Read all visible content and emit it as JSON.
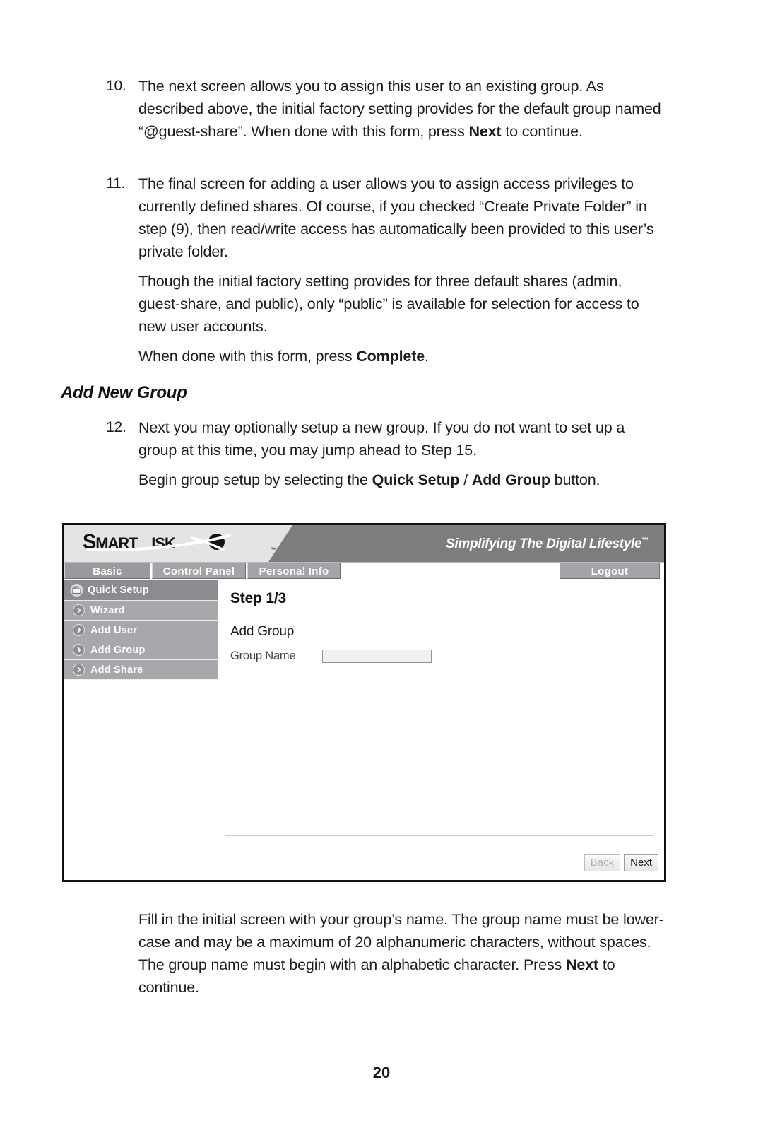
{
  "document": {
    "page_number": "20",
    "section_heading": "Add New Group",
    "items": [
      {
        "number": "10.",
        "parts": [
          {
            "t": "The next screen allows you to assign this user to an existing group. As described above, the initial factory setting provides for the default group named “@guest-share”. When done with this form, press ",
            "b": false
          },
          {
            "t": "Next",
            "b": true
          },
          {
            "t": " to continue.",
            "b": false
          }
        ]
      },
      {
        "number": "11.",
        "parts": [
          {
            "t": "The final screen for adding a user allows you to assign access privileges to currently defined shares. Of course, if you checked “Create Private Folder” in step (9), then read/write access has automatically been provided to this user’s private folder.",
            "b": false
          }
        ]
      }
    ],
    "para_11b": "Though the initial factory setting provides for three default shares (admin, guest-share, and public), only “public” is available for selection for access to new user accounts.",
    "para_11c_pre": "When done with this form, press ",
    "para_11c_bold": "Complete",
    "para_11c_post": ".",
    "item_12_number": "12.",
    "item_12_text": "Next you may optionally setup a new group. If you do not want to set up a group at this time, you may jump ahead to Step 15.",
    "item_12b_pre": "Begin group setup by selecting the ",
    "item_12b_bold1": "Quick Setup",
    "item_12b_mid": " / ",
    "item_12b_bold2": "Add Group",
    "item_12b_post": " button.",
    "closing_paragraph_pre": "Fill in the initial screen with your group’s name. The group name must be lower-case and may be a maximum of 20 alphanumeric characters, without spaces. The group name must begin with an alphabetic character. Press ",
    "closing_paragraph_bold": "Next",
    "closing_paragraph_post": " to continue."
  },
  "screenshot": {
    "brand": {
      "logo_part1": "S",
      "logo_part2": "MART",
      "logo_part3": "ISK",
      "logo_trademark": "™",
      "tagline": "Simplifying The Digital Lifestyle",
      "tagline_tm": "™"
    },
    "tabs": [
      {
        "label": "Basic",
        "active": true
      },
      {
        "label": "Control Panel",
        "active": false
      },
      {
        "label": "Personal Info",
        "active": false
      }
    ],
    "logout_label": "Logout",
    "sidebar": {
      "header": {
        "label": "Quick Setup",
        "icon": "folder-icon"
      },
      "items": [
        {
          "label": "Wizard",
          "icon": "chevron-right-circle-icon"
        },
        {
          "label": "Add User",
          "icon": "chevron-right-circle-icon"
        },
        {
          "label": "Add Group",
          "icon": "chevron-right-circle-icon"
        },
        {
          "label": "Add Share",
          "icon": "chevron-right-circle-icon"
        }
      ]
    },
    "main": {
      "step_title": "Step 1/3",
      "form_title": "Add Group",
      "field_label": "Group Name",
      "field_value": "",
      "field_placeholder": ""
    },
    "buttons": {
      "back": "Back",
      "next": "Next"
    },
    "colors": {
      "banner_light": "#e4e4e4",
      "banner_dark": "#7d7d80",
      "tab_active": "#9a9a9e",
      "tab_inactive": "#a4a4a8",
      "sidebar_header": "#8c8c90",
      "sidebar_item": "#a8a8ac",
      "frame_border": "#111111"
    }
  }
}
